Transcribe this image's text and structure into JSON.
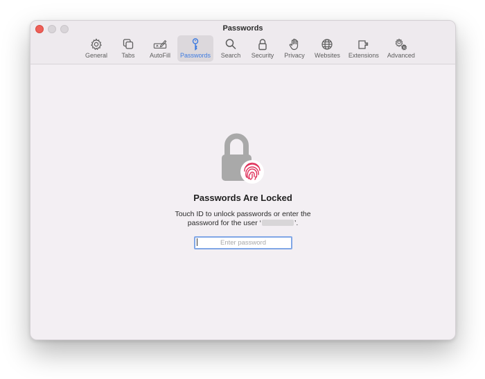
{
  "window": {
    "title": "Passwords"
  },
  "toolbar": {
    "items": [
      {
        "label": "General",
        "icon": "gear-icon"
      },
      {
        "label": "Tabs",
        "icon": "tabs-icon"
      },
      {
        "label": "AutoFill",
        "icon": "autofill-icon"
      },
      {
        "label": "Passwords",
        "icon": "key-icon",
        "selected": true
      },
      {
        "label": "Search",
        "icon": "magnifier-icon"
      },
      {
        "label": "Security",
        "icon": "lock-icon"
      },
      {
        "label": "Privacy",
        "icon": "hand-icon"
      },
      {
        "label": "Websites",
        "icon": "globe-icon"
      },
      {
        "label": "Extensions",
        "icon": "puzzle-icon"
      },
      {
        "label": "Advanced",
        "icon": "gears-icon"
      }
    ]
  },
  "locked": {
    "heading": "Passwords Are Locked",
    "description_line1": "Touch ID to unlock passwords or enter the",
    "description_line2_prefix": "password for the user ‘",
    "description_line2_suffix": "’.",
    "password_placeholder": "Enter password"
  },
  "colors": {
    "accent": "#3e7be0",
    "fingerprint": "#e0305a",
    "lock": "#a9a9a9",
    "close": "#ee5f59"
  }
}
